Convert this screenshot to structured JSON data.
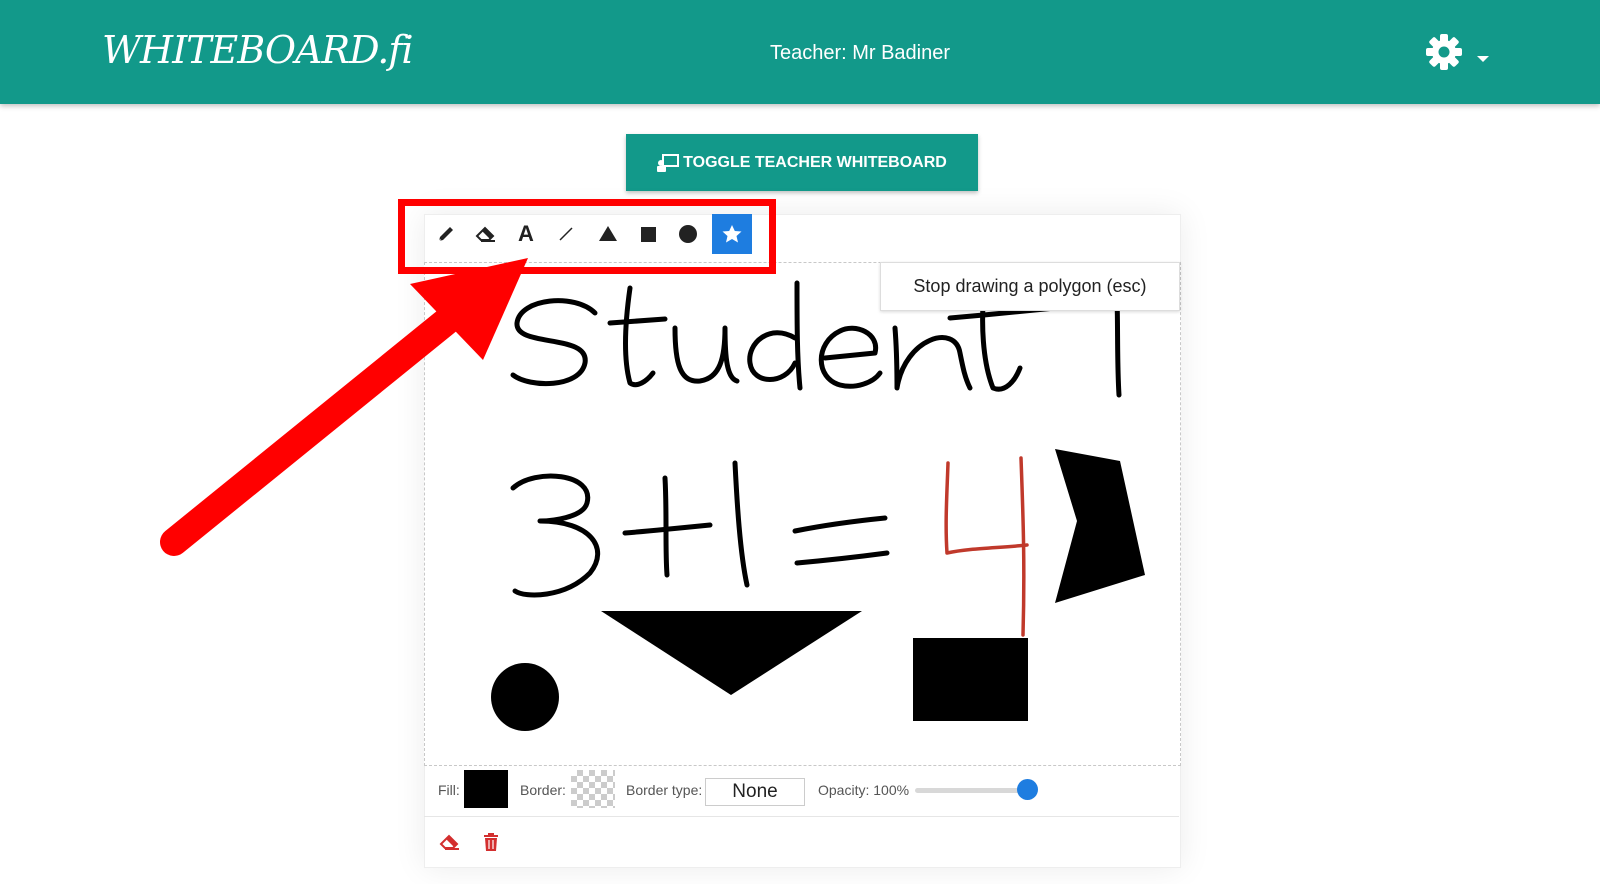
{
  "header": {
    "logo": "WHITEBOARD.fi",
    "teacher": "Teacher: Mr Badiner"
  },
  "toggle_button": {
    "label": "TOGGLE TEACHER WHITEBOARD"
  },
  "tools": [
    {
      "name": "pencil-icon"
    },
    {
      "name": "eraser-icon"
    },
    {
      "name": "text-icon",
      "glyph": "A"
    },
    {
      "name": "line-icon"
    },
    {
      "name": "triangle-icon"
    },
    {
      "name": "rectangle-icon"
    },
    {
      "name": "circle-icon"
    },
    {
      "name": "polygon-star-icon",
      "active": true
    }
  ],
  "tooltip": "Stop drawing a polygon (esc)",
  "canvas": {
    "handwriting": [
      "Student 1",
      "3+1=4"
    ],
    "accent_color": "#c0392b"
  },
  "properties": {
    "fill_label": "Fill:",
    "fill_color": "#000000",
    "border_label": "Border:",
    "border_type_label": "Border type:",
    "border_type_value": "None",
    "opacity_label": "Opacity: 100%",
    "opacity_value": 1.0
  },
  "colors": {
    "brand": "#12998a",
    "active_tool": "#1e7de0",
    "annotation": "#ff0000",
    "delete": "#d32f2f"
  }
}
